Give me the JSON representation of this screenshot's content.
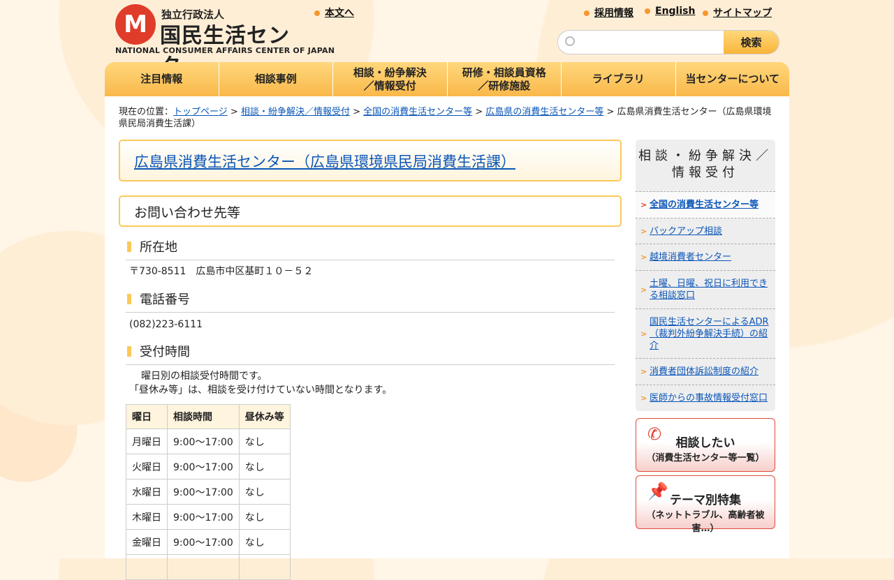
{
  "header": {
    "logo_sub": "独立行政法人",
    "logo_main": "国民生活センター",
    "logo_en": "NATIONAL CONSUMER AFFAIRS CENTER OF JAPAN",
    "skip_link": "本文へ",
    "links": [
      "採用情報",
      "English",
      "サイトマップ"
    ],
    "search_placeholder": "",
    "search_button": "検索"
  },
  "nav": [
    "注目情報",
    "相談事例",
    "相談・紛争解決\n／情報受付",
    "研修・相談員資格\n／研修施設",
    "ライブラリ",
    "当センターについて"
  ],
  "breadcrumb": {
    "prefix": "現在の位置：",
    "links": [
      "トップページ",
      "相談・紛争解決／情報受付",
      "全国の消費生活センター等",
      "広島県の消費生活センター等"
    ],
    "current": "広島県消費生活センター（広島県環境県民局消費生活課）"
  },
  "title": "広島県消費生活センター（広島県環境県民局消費生活課）",
  "section": "お問い合わせ先等",
  "address": {
    "heading": "所在地",
    "text": "〒730-8511　広島市中区基町１０－５２"
  },
  "phone": {
    "heading": "電話番号",
    "text": "(082)223-6111"
  },
  "hours": {
    "heading": "受付時間",
    "note1": "　曜日別の相談受付時間です。",
    "note2": "「昼休み等」は、相談を受け付けていない時間となります。",
    "columns": [
      "曜日",
      "相談時間",
      "昼休み等"
    ],
    "rows": [
      [
        "月曜日",
        "9:00～17:00",
        "なし"
      ],
      [
        "火曜日",
        "9:00～17:00",
        "なし"
      ],
      [
        "水曜日",
        "9:00～17:00",
        "なし"
      ],
      [
        "木曜日",
        "9:00～17:00",
        "なし"
      ],
      [
        "金曜日",
        "9:00～17:00",
        "なし"
      ]
    ]
  },
  "sidebar": {
    "heading": "相談・紛争解決／情報受付",
    "items": [
      "全国の消費生活センター等",
      "バックアップ相談",
      "越境消費者センター",
      "土曜、日曜、祝日に利用できる相談窓口",
      "国民生活センターによるADR（裁判外紛争解決手続）の紹介",
      "消費者団体訴訟制度の紹介",
      "医師からの事故情報受付窓口"
    ]
  },
  "banners": [
    {
      "title": "相談したい",
      "sub": "（消費生活センター等一覧）"
    },
    {
      "title": "テーマ別特集",
      "sub": "（ネットトラブル、高齢者被害…）"
    }
  ]
}
